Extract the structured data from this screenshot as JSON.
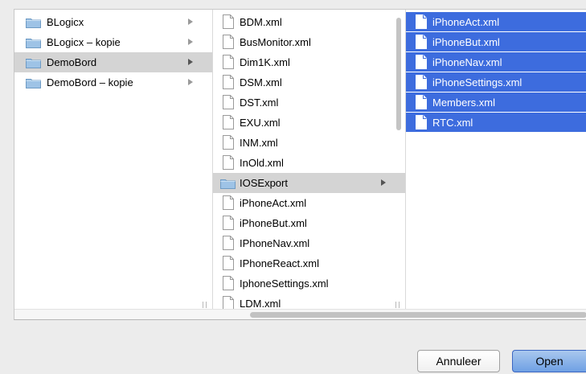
{
  "columns": [
    {
      "items": [
        {
          "label": "BLogicx",
          "icon": "folder-icon",
          "state": "normal"
        },
        {
          "label": "BLogicx – kopie",
          "icon": "folder-icon",
          "state": "normal"
        },
        {
          "label": "DemoBord",
          "icon": "folder-icon",
          "state": "path"
        },
        {
          "label": "DemoBord – kopie",
          "icon": "folder-icon",
          "state": "normal"
        }
      ]
    },
    {
      "items": [
        {
          "label": "BDM.xml",
          "icon": "document-icon",
          "state": "normal"
        },
        {
          "label": "BusMonitor.xml",
          "icon": "document-icon",
          "state": "normal"
        },
        {
          "label": "Dim1K.xml",
          "icon": "document-icon",
          "state": "normal"
        },
        {
          "label": "DSM.xml",
          "icon": "document-icon",
          "state": "normal"
        },
        {
          "label": "DST.xml",
          "icon": "document-icon",
          "state": "normal"
        },
        {
          "label": "EXU.xml",
          "icon": "document-icon",
          "state": "normal"
        },
        {
          "label": "INM.xml",
          "icon": "document-icon",
          "state": "normal"
        },
        {
          "label": "InOld.xml",
          "icon": "document-icon",
          "state": "normal"
        },
        {
          "label": "IOSExport",
          "icon": "folder-icon",
          "state": "path"
        },
        {
          "label": "iPhoneAct.xml",
          "icon": "document-icon",
          "state": "normal"
        },
        {
          "label": "iPhoneBut.xml",
          "icon": "document-icon",
          "state": "normal"
        },
        {
          "label": "IPhoneNav.xml",
          "icon": "document-icon",
          "state": "normal"
        },
        {
          "label": "IPhoneReact.xml",
          "icon": "document-icon",
          "state": "normal"
        },
        {
          "label": "IphoneSettings.xml",
          "icon": "document-icon",
          "state": "normal"
        },
        {
          "label": "LDM.xml",
          "icon": "document-icon",
          "state": "normal"
        }
      ]
    },
    {
      "items": [
        {
          "label": "iPhoneAct.xml",
          "icon": "document-icon",
          "state": "selected"
        },
        {
          "label": "iPhoneBut.xml",
          "icon": "document-icon",
          "state": "selected"
        },
        {
          "label": "iPhoneNav.xml",
          "icon": "document-icon",
          "state": "selected"
        },
        {
          "label": "iPhoneSettings.xml",
          "icon": "document-icon",
          "state": "selected"
        },
        {
          "label": "Members.xml",
          "icon": "document-icon",
          "state": "selected"
        },
        {
          "label": "RTC.xml",
          "icon": "document-icon",
          "state": "selected"
        }
      ]
    }
  ],
  "buttons": {
    "cancel_label": "Annuleer",
    "open_label": "Open"
  },
  "colors": {
    "selection": "#3d6cde",
    "path_highlight": "#d4d4d4",
    "folder": "#9ec3e6",
    "primary_button": "#6fa0e4"
  }
}
